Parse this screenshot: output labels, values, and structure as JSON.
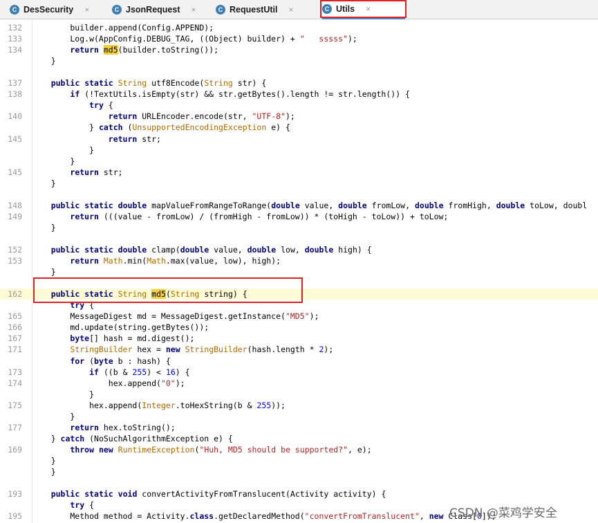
{
  "tabs": [
    {
      "label": "DesSecurity",
      "icon": "class-icon",
      "icon_letter": "C",
      "active": false
    },
    {
      "label": "JsonRequest",
      "icon": "class-icon",
      "icon_letter": "C",
      "active": false
    },
    {
      "label": "RequestUtil",
      "icon": "class-icon",
      "icon_letter": "C",
      "active": false
    },
    {
      "label": "Utils",
      "icon": "class-icon",
      "icon_letter": "C",
      "active": true
    }
  ],
  "close_glyph": "×",
  "accent_colors": {
    "highlight_box": "#e02020",
    "keyword": "#000080",
    "string": "#b22222",
    "type": "#b06a00",
    "number": "#0000ff",
    "current_line": "#fcfbd6"
  },
  "lines": [
    {
      "n": "132",
      "t": "        builder.append(Config.APPEND);"
    },
    {
      "n": "133",
      "t": "        Log.w(AppConfig.DEBUG_TAG, ((Object) builder) + \"   sssss\");"
    },
    {
      "n": "134",
      "t": "        return md5(builder.toString());"
    },
    {
      "n": "",
      "t": "    }"
    },
    {
      "n": "",
      "t": ""
    },
    {
      "n": "137",
      "t": "    public static String utf8Encode(String str) {"
    },
    {
      "n": "138",
      "t": "        if (!TextUtils.isEmpty(str) && str.getBytes().length != str.length()) {"
    },
    {
      "n": "",
      "t": "            try {"
    },
    {
      "n": "140",
      "t": "                return URLEncoder.encode(str, \"UTF-8\");"
    },
    {
      "n": "",
      "t": "            } catch (UnsupportedEncodingException e) {"
    },
    {
      "n": "145",
      "t": "                return str;"
    },
    {
      "n": "",
      "t": "            }"
    },
    {
      "n": "",
      "t": "        }"
    },
    {
      "n": "145",
      "t": "        return str;"
    },
    {
      "n": "",
      "t": "    }"
    },
    {
      "n": "",
      "t": ""
    },
    {
      "n": "148",
      "t": "    public static double mapValueFromRangeToRange(double value, double fromLow, double fromHigh, double toLow, doubl"
    },
    {
      "n": "149",
      "t": "        return (((value - fromLow) / (fromHigh - fromLow)) * (toHigh - toLow)) + toLow;"
    },
    {
      "n": "",
      "t": "    }"
    },
    {
      "n": "",
      "t": ""
    },
    {
      "n": "152",
      "t": "    public static double clamp(double value, double low, double high) {"
    },
    {
      "n": "153",
      "t": "        return Math.min(Math.max(value, low), high);"
    },
    {
      "n": "",
      "t": "    }"
    },
    {
      "n": "",
      "t": ""
    },
    {
      "n": "162",
      "t": "    public static String md5(String string) {"
    },
    {
      "n": "",
      "t": "        try {"
    },
    {
      "n": "165",
      "t": "        MessageDigest md = MessageDigest.getInstance(\"MD5\");"
    },
    {
      "n": "166",
      "t": "        md.update(string.getBytes());"
    },
    {
      "n": "167",
      "t": "        byte[] hash = md.digest();"
    },
    {
      "n": "171",
      "t": "        StringBuilder hex = new StringBuilder(hash.length * 2);"
    },
    {
      "n": "",
      "t": "        for (byte b : hash) {"
    },
    {
      "n": "173",
      "t": "            if ((b & 255) < 16) {"
    },
    {
      "n": "174",
      "t": "                hex.append(\"0\");"
    },
    {
      "n": "",
      "t": "            }"
    },
    {
      "n": "175",
      "t": "            hex.append(Integer.toHexString(b & 255));"
    },
    {
      "n": "",
      "t": "        }"
    },
    {
      "n": "177",
      "t": "        return hex.toString();"
    },
    {
      "n": "",
      "t": "    } catch (NoSuchAlgorithmException e) {"
    },
    {
      "n": "169",
      "t": "        throw new RuntimeException(\"Huh, MD5 should be supported?\", e);"
    },
    {
      "n": "",
      "t": "    }"
    },
    {
      "n": "",
      "t": "    }"
    },
    {
      "n": "",
      "t": ""
    },
    {
      "n": "193",
      "t": "    public static void convertActivityFromTranslucent(Activity activity) {"
    },
    {
      "n": "",
      "t": "        try {"
    },
    {
      "n": "195",
      "t": "        Method method = Activity.class.getDeclaredMethod(\"convertFromTranslucent\", new Class[0]);"
    }
  ],
  "current_line_number": "162",
  "watermark": "CSDN @菜鸡学安全"
}
